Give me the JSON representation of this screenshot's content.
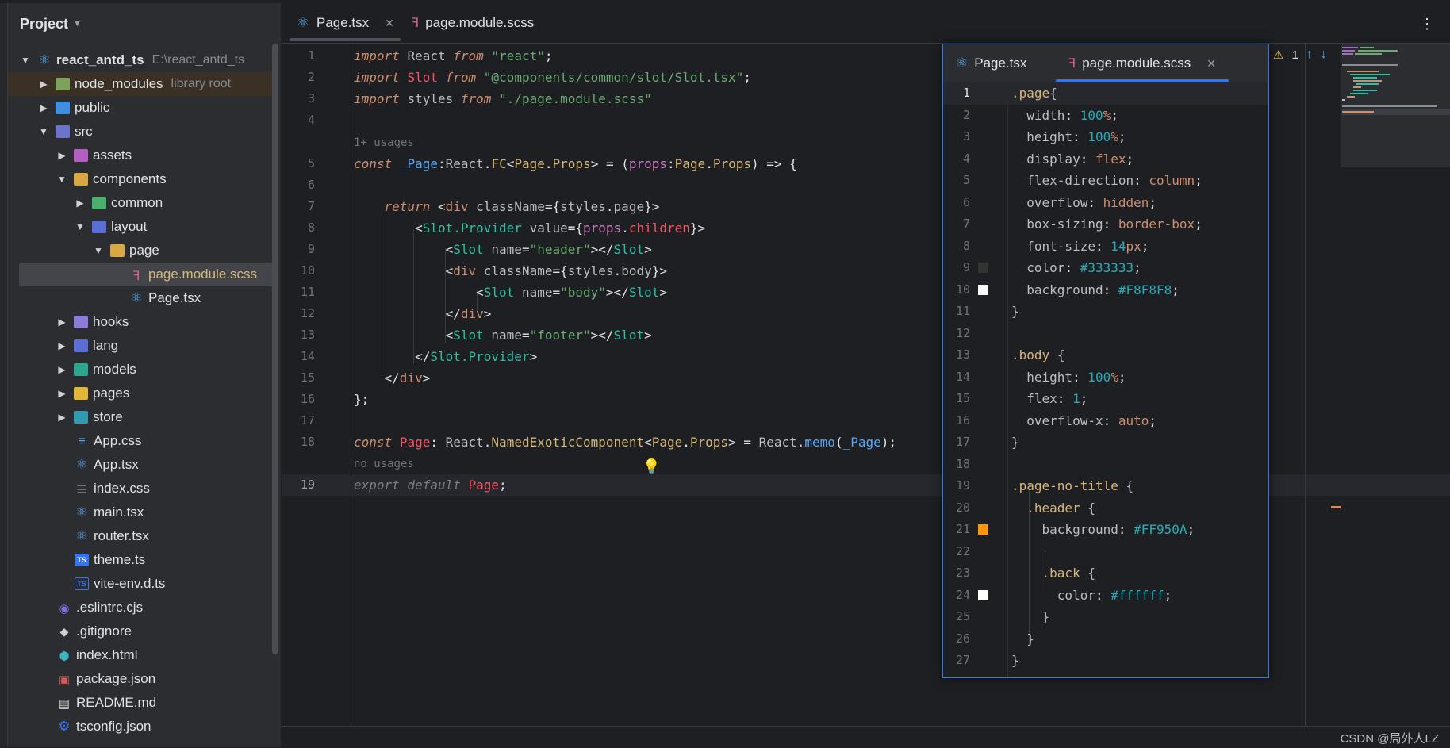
{
  "sidebar": {
    "title": "Project",
    "tree": [
      {
        "label": "react_antd_ts",
        "secondary": "E:\\react_antd_ts",
        "icon": "root-module-icon"
      },
      {
        "label": "node_modules",
        "secondary": "library root",
        "icon": "folder-library-icon"
      },
      {
        "label": "public",
        "icon": "folder-public-icon"
      },
      {
        "label": "src",
        "icon": "folder-src-icon"
      },
      {
        "label": "assets",
        "icon": "folder-assets-icon"
      },
      {
        "label": "components",
        "icon": "folder-components-icon"
      },
      {
        "label": "common",
        "icon": "folder-icon"
      },
      {
        "label": "layout",
        "icon": "folder-layout-icon"
      },
      {
        "label": "page",
        "icon": "folder-open-icon"
      },
      {
        "label": "page.module.scss",
        "icon": "scss-file-icon"
      },
      {
        "label": "Page.tsx",
        "icon": "react-file-icon"
      },
      {
        "label": "hooks",
        "icon": "folder-hooks-icon"
      },
      {
        "label": "lang",
        "icon": "folder-lang-icon"
      },
      {
        "label": "models",
        "icon": "folder-models-icon"
      },
      {
        "label": "pages",
        "icon": "folder-pages-icon"
      },
      {
        "label": "store",
        "icon": "folder-store-icon"
      },
      {
        "label": "App.css",
        "icon": "css-file-icon"
      },
      {
        "label": "App.tsx",
        "icon": "react-file-icon"
      },
      {
        "label": "index.css",
        "icon": "css-list-icon"
      },
      {
        "label": "main.tsx",
        "icon": "react-file-icon"
      },
      {
        "label": "router.tsx",
        "icon": "react-file-icon"
      },
      {
        "label": "theme.ts",
        "icon": "ts-file-icon"
      },
      {
        "label": "vite-env.d.ts",
        "icon": "ts-def-file-icon"
      },
      {
        "label": ".eslintrc.cjs",
        "icon": "eslint-file-icon"
      },
      {
        "label": ".gitignore",
        "icon": "git-file-icon"
      },
      {
        "label": "index.html",
        "icon": "html-file-icon"
      },
      {
        "label": "package.json",
        "icon": "npm-file-icon"
      },
      {
        "label": "README.md",
        "icon": "markdown-file-icon"
      },
      {
        "label": "tsconfig.json",
        "icon": "tsconfig-file-icon"
      }
    ]
  },
  "tabs": [
    {
      "label": "Page.tsx",
      "icon": "react-file-icon",
      "active": true
    },
    {
      "label": "page.module.scss",
      "icon": "scss-file-icon",
      "active": false
    }
  ],
  "editor": {
    "line_numbers": [
      "1",
      "2",
      "3",
      "4",
      "5",
      "6",
      "7",
      "8",
      "9",
      "10",
      "11",
      "12",
      "13",
      "14",
      "15",
      "16",
      "17",
      "18",
      "19"
    ],
    "usages_hint_1": "1+ usages",
    "usages_hint_2": "no usages",
    "warning_count": "1"
  },
  "popup": {
    "tabs": [
      {
        "label": "Page.tsx",
        "icon": "react-file-icon"
      },
      {
        "label": "page.module.scss",
        "icon": "scss-file-icon",
        "active": true
      }
    ],
    "line_numbers": [
      "1",
      "2",
      "3",
      "4",
      "5",
      "6",
      "7",
      "8",
      "9",
      "10",
      "11",
      "12",
      "13",
      "14",
      "15",
      "16",
      "17",
      "18",
      "19",
      "20",
      "21",
      "22",
      "23",
      "24",
      "25",
      "26",
      "27"
    ],
    "swatches": {
      "9": "#333333",
      "10": "#F8F8F8",
      "21": "#FF950A",
      "24": "#ffffff"
    }
  },
  "footer": {
    "credit": "CSDN @局外人LZ"
  },
  "colors": {
    "accent": "#3574f0",
    "background": "#1e1f22",
    "sidebar": "#2b2d30"
  }
}
